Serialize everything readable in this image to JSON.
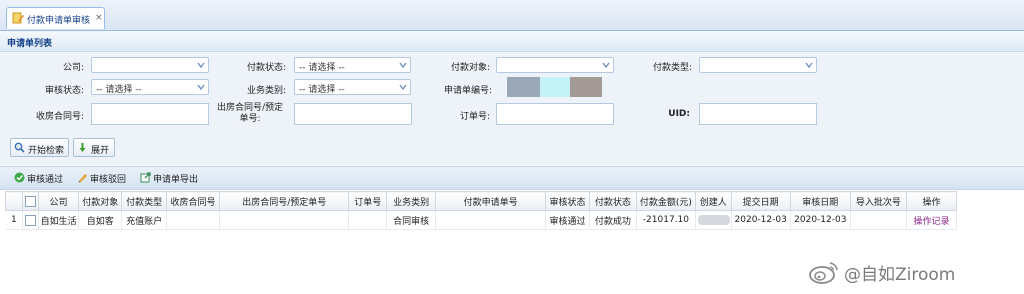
{
  "tab": {
    "title": "付款申请单审核",
    "close": "×"
  },
  "panel": {
    "title": "申请单列表"
  },
  "form": {
    "company": {
      "label": "公司:",
      "value": ""
    },
    "pay_status": {
      "label": "付款状态:",
      "value": "-- 请选择 --"
    },
    "pay_target": {
      "label": "付款对象:",
      "value": ""
    },
    "pay_type": {
      "label": "付款类型:",
      "value": ""
    },
    "audit_status": {
      "label": "审核状态:",
      "value": "-- 请选择 --"
    },
    "biz_type": {
      "label": "业务类别:",
      "value": "-- 请选择 --"
    },
    "apply_no": {
      "label": "申请单编号:",
      "value": ""
    },
    "contract_in": {
      "label": "收房合同号:",
      "value": ""
    },
    "contract_out": {
      "label": "出房合同号/预定单号:",
      "value": ""
    },
    "order_no": {
      "label": "订单号:",
      "value": ""
    },
    "uid": {
      "label": "UID:",
      "value": ""
    }
  },
  "buttons": {
    "search": "开始检索",
    "expand": "展开"
  },
  "toolbar": {
    "approve": "审核通过",
    "reject": "审核驳回",
    "export": "申请单导出"
  },
  "table": {
    "headers": [
      "",
      "",
      "公司",
      "付款对象",
      "付款类型",
      "收房合同号",
      "出房合同号/预定单号",
      "订单号",
      "业务类别",
      "付款申请单号",
      "审核状态",
      "付款状态",
      "付款金额(元)",
      "创建人",
      "提交日期",
      "审核日期",
      "导入批次号",
      "操作"
    ],
    "rows": [
      {
        "index": "1",
        "company": "自如生活",
        "target": "自如客",
        "type": "充值账户",
        "contract_in": "",
        "contract_out": "",
        "order_no": "",
        "biz": "合同审核",
        "apply_no": "",
        "audit": "审核通过",
        "pay_status": "付款成功",
        "amount": "-21017.10",
        "creator": "",
        "submit": "2020-12-03",
        "audit_date": "2020-12-03",
        "batch": "",
        "op": "操作记录"
      }
    ]
  },
  "watermark": {
    "text": "@自如Ziroom"
  },
  "colors": {
    "header_text": "#15428b",
    "link": "#8a1f86",
    "border": "#99bbe8"
  }
}
